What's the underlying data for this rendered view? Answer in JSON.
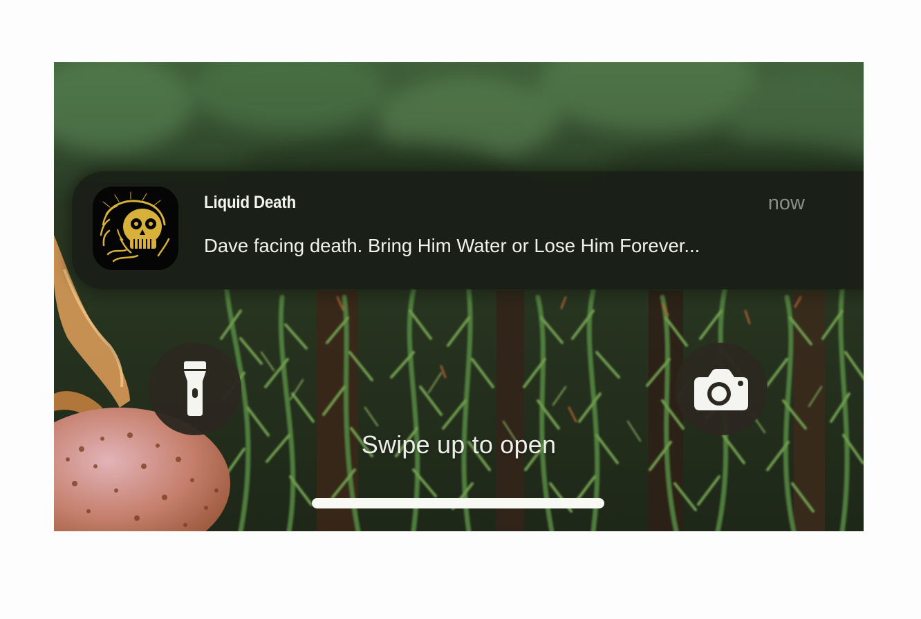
{
  "notification": {
    "app_name": "Liquid Death",
    "time": "now",
    "message": "Dave facing death. Bring Him Water or Lose Him Forever...",
    "app_icon": "liquid-death-skull-logo-icon"
  },
  "lock_screen": {
    "swipe_hint": "Swipe up to open",
    "left_button_icon": "flashlight-icon",
    "right_button_icon": "camera-icon"
  },
  "colors": {
    "notification_background": "#1a1f16",
    "button_background": "#2c2820",
    "text_primary": "#f1f1ee",
    "text_secondary": "#8b8e86",
    "logo_gold": "#d7b13a"
  }
}
